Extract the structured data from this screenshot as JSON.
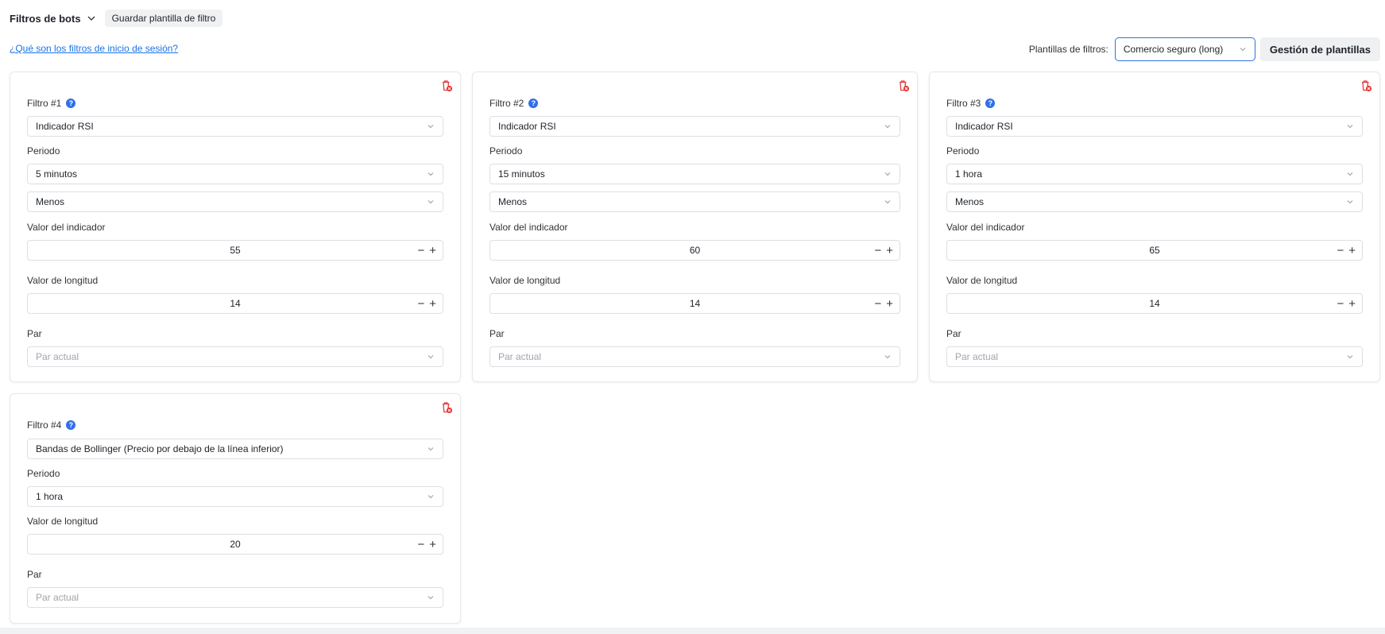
{
  "header": {
    "title": "Filtros de bots",
    "save_template": "Guardar plantilla de filtro",
    "help_link": "¿Qué son los filtros de inicio de sesión?",
    "templates_label": "Plantillas de filtros:",
    "template_selected": "Comercio seguro (long)",
    "manage_templates": "Gestión de plantillas"
  },
  "labels": {
    "periodo": "Periodo",
    "valor_indicador": "Valor del indicador",
    "valor_longitud": "Valor de longitud",
    "par": "Par",
    "par_placeholder": "Par actual",
    "minus": "−",
    "plus": "+"
  },
  "filters": [
    {
      "title": "Filtro #1",
      "indicator": "Indicador RSI",
      "period": "5 minutos",
      "condition": "Menos",
      "indicator_value": "55",
      "length_value": "14"
    },
    {
      "title": "Filtro #2",
      "indicator": "Indicador RSI",
      "period": "15 minutos",
      "condition": "Menos",
      "indicator_value": "60",
      "length_value": "14"
    },
    {
      "title": "Filtro #3",
      "indicator": "Indicador RSI",
      "period": "1 hora",
      "condition": "Menos",
      "indicator_value": "65",
      "length_value": "14"
    },
    {
      "title": "Filtro #4",
      "indicator": "Bandas de Bollinger (Precio por debajo de la línea inferior)",
      "period": "1 hora",
      "length_value": "20"
    }
  ],
  "colors": {
    "accent": "#2f6feb",
    "link": "#1a73e8",
    "danger": "#e53935"
  }
}
